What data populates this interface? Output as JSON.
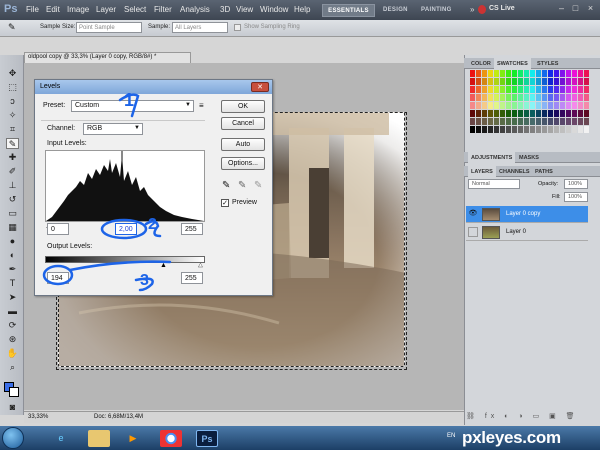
{
  "app": {
    "logo": "Ps",
    "menus": [
      "File",
      "Edit",
      "Image",
      "Layer",
      "Select",
      "Filter",
      "Analysis",
      "3D",
      "View",
      "Window",
      "Help"
    ],
    "workspaces": [
      "ESSENTIALS",
      "DESIGN",
      "PAINTING"
    ],
    "cs_live": "CS Live"
  },
  "options_bar": {
    "sample_size_label": "Sample Size:",
    "sample_size_value": "Point Sample",
    "sample_label": "Sample:",
    "sample_value": "All Layers",
    "show_ring_label": "Show Sampling Ring"
  },
  "document": {
    "tab_title": "oldpool copy @ 33,3% (Layer 0 copy, RGB/8#) *"
  },
  "status": {
    "zoom": "33,33%",
    "doc_info": "Doc: 6,68M/13,4M"
  },
  "levels_dialog": {
    "title": "Levels",
    "preset_label": "Preset:",
    "preset_value": "Custom",
    "channel_label": "Channel:",
    "channel_value": "RGB",
    "input_levels_label": "Input Levels:",
    "input_black": "0",
    "input_gamma": "2,00",
    "input_white": "255",
    "output_levels_label": "Output Levels:",
    "output_black": "194",
    "output_white": "255",
    "buttons": {
      "ok": "OK",
      "cancel": "Cancel",
      "auto": "Auto",
      "options": "Options..."
    },
    "preview_label": "Preview",
    "annotations": [
      "1",
      "2",
      "3"
    ]
  },
  "panels": {
    "color_tabs": [
      "COLOR",
      "SWATCHES",
      "STYLES"
    ],
    "adjust_tabs": [
      "ADJUSTMENTS",
      "MASKS"
    ],
    "layer_tabs": [
      "LAYERS",
      "CHANNELS",
      "PATHS"
    ],
    "blend_mode": "Normal",
    "opacity_label": "Opacity:",
    "opacity_value": "100%",
    "fill_label": "Fill:",
    "fill_value": "100%",
    "layers": [
      {
        "name": "Layer 0 copy",
        "selected": true
      },
      {
        "name": "Layer 0",
        "selected": false
      }
    ]
  },
  "taskbar": {
    "lang": "EN"
  },
  "watermark": "pxleyes.com",
  "colors": {
    "accent": "#1d64e8",
    "selected_layer": "#3d8ee8"
  }
}
